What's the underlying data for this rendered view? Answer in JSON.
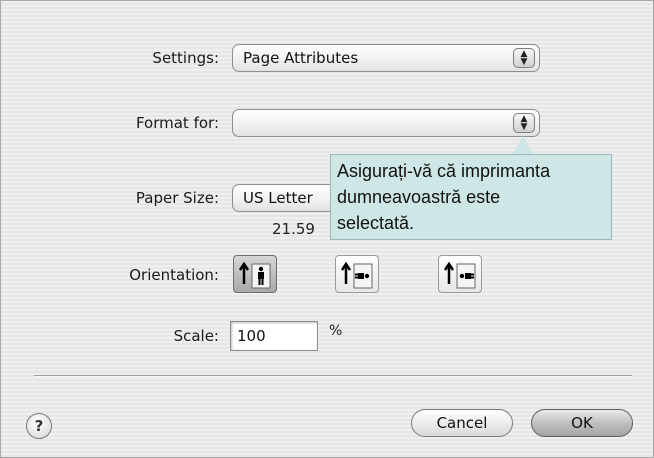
{
  "settings": {
    "label": "Settings:",
    "value": "Page Attributes"
  },
  "format_for": {
    "label": "Format for:",
    "value": ""
  },
  "tooltip": {
    "line1": "Asigurați-vă că imprimanta",
    "line2": "dumneavoastră este",
    "line3": "selectată."
  },
  "paper_size": {
    "label": "Paper Size:",
    "value": "US Letter",
    "dimensions_partial": "21.59"
  },
  "orientation": {
    "label": "Orientation:",
    "options": [
      "portrait",
      "landscape-left",
      "landscape-right"
    ],
    "selected": "portrait"
  },
  "scale": {
    "label": "Scale:",
    "value": "100",
    "unit": "%"
  },
  "buttons": {
    "help": "?",
    "cancel": "Cancel",
    "ok": "OK"
  }
}
